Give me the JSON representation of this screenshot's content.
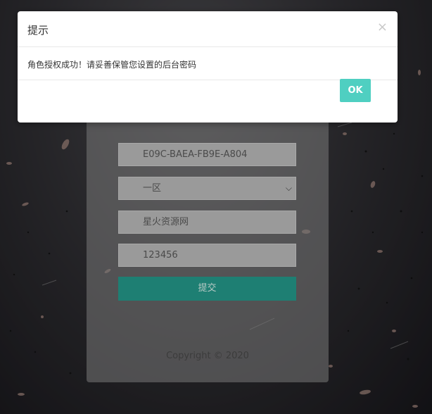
{
  "modal": {
    "title": "提示",
    "close_icon": "×",
    "message": "角色授权成功！请妥善保管您设置的后台密码",
    "ok_label": "OK",
    "ok_color": "#4fcfc1"
  },
  "form": {
    "code_value": "E09C-BAEA-FB9E-A804",
    "server_value": "一区",
    "role_value": "星火资源网",
    "password_value": "123456",
    "submit_label": "提交",
    "submit_color": "#1e7f73"
  },
  "footer": {
    "copyright": "Copyright © 2020"
  }
}
